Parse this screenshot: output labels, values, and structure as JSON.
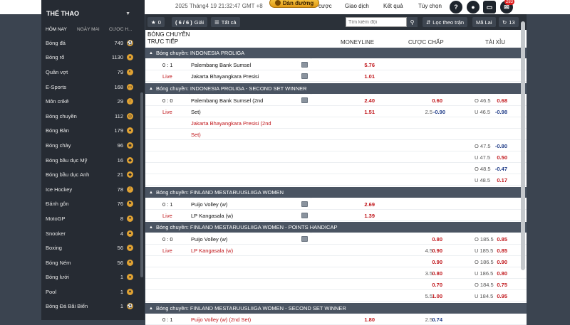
{
  "header": {
    "datetime": "2025 Tháng4 19 21:32:47 GMT +8",
    "deposit_label": "Dàn đường",
    "links": [
      "cược",
      "Giao dịch",
      "Kết quả",
      "Tùy chọn"
    ],
    "icons": [
      "help-icon",
      "user-icon",
      "screen-icon",
      "mail-icon"
    ],
    "notification_count": "283"
  },
  "sidebar": {
    "title": "THỂ THAO",
    "tabs": [
      "HÔM NAY",
      "NGÀY MAI",
      "CƯỢC H..."
    ],
    "items": [
      {
        "label": "Bóng đá",
        "count": "749",
        "icon": "soccer-icon"
      },
      {
        "label": "Bóng rổ",
        "count": "1130",
        "icon": "basketball-icon"
      },
      {
        "label": "Quần vợt",
        "count": "79",
        "icon": "tennis-icon"
      },
      {
        "label": "E-Sports",
        "count": "168",
        "icon": "gamepad-icon"
      },
      {
        "label": "Môn crikê",
        "count": "29",
        "icon": "cricket-icon"
      },
      {
        "label": "Bóng chuyền",
        "count": "112",
        "icon": "volleyball-icon"
      },
      {
        "label": "Bóng Bàn",
        "count": "179",
        "icon": "table-tennis-icon"
      },
      {
        "label": "Bóng chày",
        "count": "96",
        "icon": "baseball-icon"
      },
      {
        "label": "Bóng bầu dục Mỹ",
        "count": "16",
        "icon": "american-football-icon"
      },
      {
        "label": "Bóng bầu dục Anh",
        "count": "21",
        "icon": "rugby-icon"
      },
      {
        "label": "Ice Hockey",
        "count": "78",
        "icon": "hockey-icon"
      },
      {
        "label": "Đánh gôn",
        "count": "76",
        "icon": "golf-icon"
      },
      {
        "label": "MotoGP",
        "count": "8",
        "icon": "motorbike-icon"
      },
      {
        "label": "Snooker",
        "count": "4",
        "icon": "snooker-icon"
      },
      {
        "label": "Boxing",
        "count": "56",
        "icon": "boxing-icon"
      },
      {
        "label": "Bóng Ném",
        "count": "56",
        "icon": "handball-icon"
      },
      {
        "label": "Bóng lưới",
        "count": "1",
        "icon": "netball-icon"
      },
      {
        "label": "Pool",
        "count": "1",
        "icon": "pool-icon"
      },
      {
        "label": "Bóng Đá Bãi Biển",
        "count": "1",
        "icon": "beach-soccer-icon"
      }
    ]
  },
  "toolbar": {
    "star_count": "0",
    "page_label": "( 6 / 6 )",
    "mode_label": "Giải",
    "all_label": "Tất cả",
    "search_placeholder": "Tìm kiếm đội",
    "filter_label": "Lọc theo trận",
    "refresh_label": "Mã Lai",
    "reload_count": "13"
  },
  "columns": {
    "sport": "BÓNG CHUYỀN",
    "section": "TRỰC TIẾP",
    "moneyline": "MONEYLINE",
    "handicap": "CƯỢC CHẤP",
    "overunder": "TÀI XỈU"
  },
  "leagues": [
    {
      "name": "Bóng chuyền: INDONESIA PROLIGA"
    },
    {
      "name": "Bóng chuyền: INDONESIA PROLIGA - SECOND SET WINNER"
    },
    {
      "name": "Bóng chuyền: FINLAND MESTARUUSLIIGA WOMEN"
    },
    {
      "name": "Bóng chuyền: FINLAND MESTARUUSLIIGA WOMEN - POINTS HANDICAP"
    },
    {
      "name": "Bóng chuyền: FINLAND MESTARUUSLIIGA WOMEN - SECOND SET WINNER"
    }
  ],
  "matches": {
    "m1": {
      "score": "0 : 1",
      "status": "Live",
      "home": "Palembang Bank Sumsel",
      "away": "Jakarta Bhayangkara Presisi",
      "ml_home": "5.76",
      "ml_away": "1.01"
    },
    "m2": {
      "score": "0 : 0",
      "status": "Live",
      "home_l1": "Palembang Bank Sumsel (2nd",
      "home_l2": "Set)",
      "away_l1": "Jakarta Bhayangkara Presisi (2nd",
      "away_l2": "Set)",
      "ml_home": "2.40",
      "ml_away": "1.51",
      "hd_home": "0.60",
      "hd_line": "2.5",
      "hd_away": "-0.90",
      "ou": [
        {
          "lbl": "O 46.5",
          "val": "0.68"
        },
        {
          "lbl": "U 46.5",
          "val": "-0.98"
        },
        {
          "lbl": "O 47.5",
          "val": "-0.80"
        },
        {
          "lbl": "U 47.5",
          "val": "0.50"
        },
        {
          "lbl": "O 48.5",
          "val": "-0.47"
        },
        {
          "lbl": "U 48.5",
          "val": "0.17"
        }
      ]
    },
    "m3": {
      "score": "0 : 1",
      "status": "Live",
      "home": "Puijo Volley (w)",
      "away": "LP Kangasala (w)",
      "ml_home": "2.69",
      "ml_away": "1.39"
    },
    "m4": {
      "score": "0 : 0",
      "status": "Live",
      "home": "Puijo Volley (w)",
      "away": "LP Kangasala (w)",
      "hd": [
        {
          "line": "",
          "val": "0.80"
        },
        {
          "line": "4.5",
          "val": "0.90"
        },
        {
          "line": "",
          "val": "0.90"
        },
        {
          "line": "3.5",
          "val": "0.80"
        },
        {
          "line": "",
          "val": "0.70"
        },
        {
          "line": "5.5",
          "val": "1.00"
        }
      ],
      "ou": [
        {
          "lbl": "O 185.5",
          "val": "0.85"
        },
        {
          "lbl": "U 185.5",
          "val": "0.85"
        },
        {
          "lbl": "O 186.5",
          "val": "0.90"
        },
        {
          "lbl": "U 186.5",
          "val": "0.80"
        },
        {
          "lbl": "O 184.5",
          "val": "0.75"
        },
        {
          "lbl": "U 184.5",
          "val": "0.95"
        }
      ]
    },
    "m5": {
      "score": "0 : 1",
      "home": "Puijo Volley (w) (2nd Set)",
      "ml_home": "1.80",
      "hd_line": "2.5",
      "hd_home": "0.74"
    }
  }
}
